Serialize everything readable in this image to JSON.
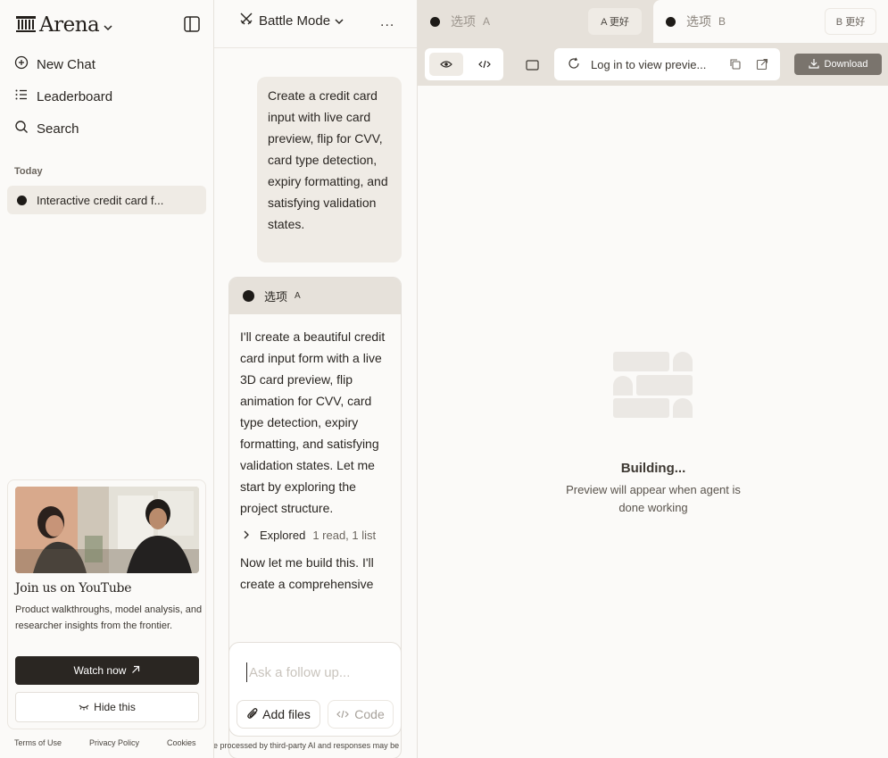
{
  "sidebar": {
    "brand": "Arena",
    "nav": [
      {
        "label": "New Chat",
        "icon": "plus-circle-icon"
      },
      {
        "label": "Leaderboard",
        "icon": "list-icon"
      },
      {
        "label": "Search",
        "icon": "search-icon"
      }
    ],
    "section_today": "Today",
    "history": [
      {
        "label": "Interactive credit card f..."
      }
    ],
    "promo": {
      "title": "Join us on YouTube",
      "description": "Product walkthroughs, model analysis, and researcher insights from the frontier.",
      "watch_label": "Watch now",
      "hide_label": "Hide this"
    },
    "footer": {
      "terms": "Terms of Use",
      "privacy": "Privacy Policy",
      "cookies": "Cookies"
    }
  },
  "chat": {
    "mode_label": "Battle Mode",
    "more_label": "...",
    "user_message": "Create a credit card input with live card preview, flip for CVV, card type detection, expiry formatting, and satisfying validation states.",
    "answer": {
      "option_name": "选项",
      "option_letter": "A",
      "text_1": "I'll create a beautiful credit card input form with a live 3D card preview, flip animation for CVV, card type detection, expiry formatting, and satisfying validation states. Let me start by exploring the project structure.",
      "explored_label": "Explored",
      "explored_meta": "1 read, 1 list",
      "text_2": "Now let me build this. I'll create a comprehensive"
    },
    "composer": {
      "placeholder": "Ask a follow up...",
      "add_files_label": "Add files",
      "code_label": "Code"
    },
    "disclaimer": "re processed by third-party AI and responses may be"
  },
  "preview": {
    "tabs": [
      {
        "name": "选项",
        "letter": "A",
        "vote_label": "A 更好"
      },
      {
        "name": "选项",
        "letter": "B",
        "vote_label": "B 更好"
      }
    ],
    "url_text": "Log in to view previe...",
    "download_label": "Download",
    "building_title": "Building...",
    "building_subtitle": "Preview will appear when agent is done working"
  }
}
